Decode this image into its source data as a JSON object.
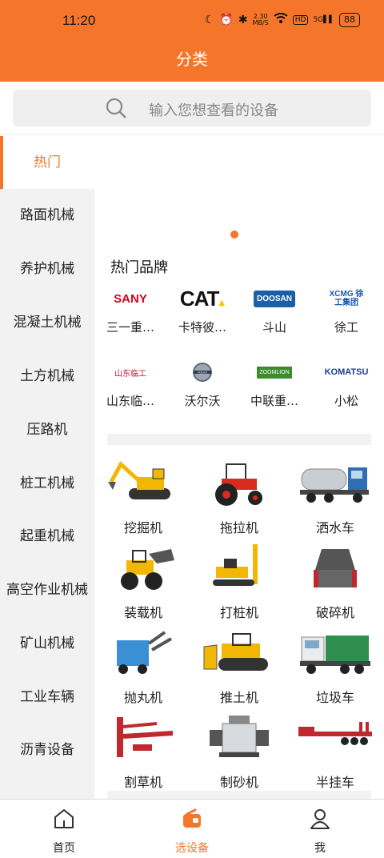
{
  "status_bar": {
    "time": "11:20",
    "speed": "2.30\nMB/S",
    "battery": "88",
    "network": "5G",
    "hd": "HD"
  },
  "header": {
    "title": "分类"
  },
  "search": {
    "placeholder": "输入您想查看的设备"
  },
  "sidebar": {
    "items": [
      {
        "label": "热门",
        "active": true
      },
      {
        "label": "路面机械"
      },
      {
        "label": "养护机械"
      },
      {
        "label": "混凝土机械"
      },
      {
        "label": "土方机械"
      },
      {
        "label": "压路机"
      },
      {
        "label": "桩工机械"
      },
      {
        "label": "起重机械"
      },
      {
        "label": "高空作业机械"
      },
      {
        "label": "矿山机械"
      },
      {
        "label": "工业车辆"
      },
      {
        "label": "沥青设备"
      }
    ]
  },
  "brands": {
    "title": "热门品牌",
    "items": [
      {
        "name": "三一重…",
        "logo_text": "SANY",
        "color": "#D6001C"
      },
      {
        "name": "卡特彼…",
        "logo_text": "CAT",
        "color": "#111111"
      },
      {
        "name": "斗山",
        "logo_text": "DOOSAN",
        "color": "#1B5FA8"
      },
      {
        "name": "徐工",
        "logo_text": "XCMG 徐工集团",
        "color": "#1C5BAA"
      },
      {
        "name": "山东临…",
        "logo_text": "山东临工",
        "color": "#C8102E"
      },
      {
        "name": "沃尔沃",
        "logo_text": "VOLVO",
        "color": "#6B7B8C"
      },
      {
        "name": "中联重…",
        "logo_text": "ZOOMLION",
        "color": "#3D8B2E"
      },
      {
        "name": "小松",
        "logo_text": "KOMATSU",
        "color": "#1B3F8F"
      }
    ]
  },
  "equipment": [
    {
      "label": "挖掘机"
    },
    {
      "label": "拖拉机"
    },
    {
      "label": "洒水车"
    },
    {
      "label": "装载机"
    },
    {
      "label": "打桩机"
    },
    {
      "label": "破碎机"
    },
    {
      "label": "抛丸机"
    },
    {
      "label": "推土机"
    },
    {
      "label": "垃圾车"
    },
    {
      "label": "割草机"
    },
    {
      "label": "制砂机"
    },
    {
      "label": "半挂车"
    }
  ],
  "bottom_nav": {
    "tabs": [
      {
        "label": "首页"
      },
      {
        "label": "选设备",
        "active": true
      },
      {
        "label": "我"
      }
    ]
  },
  "colors": {
    "accent": "#F5762A",
    "sidebar_bg": "#F2F2F2"
  }
}
